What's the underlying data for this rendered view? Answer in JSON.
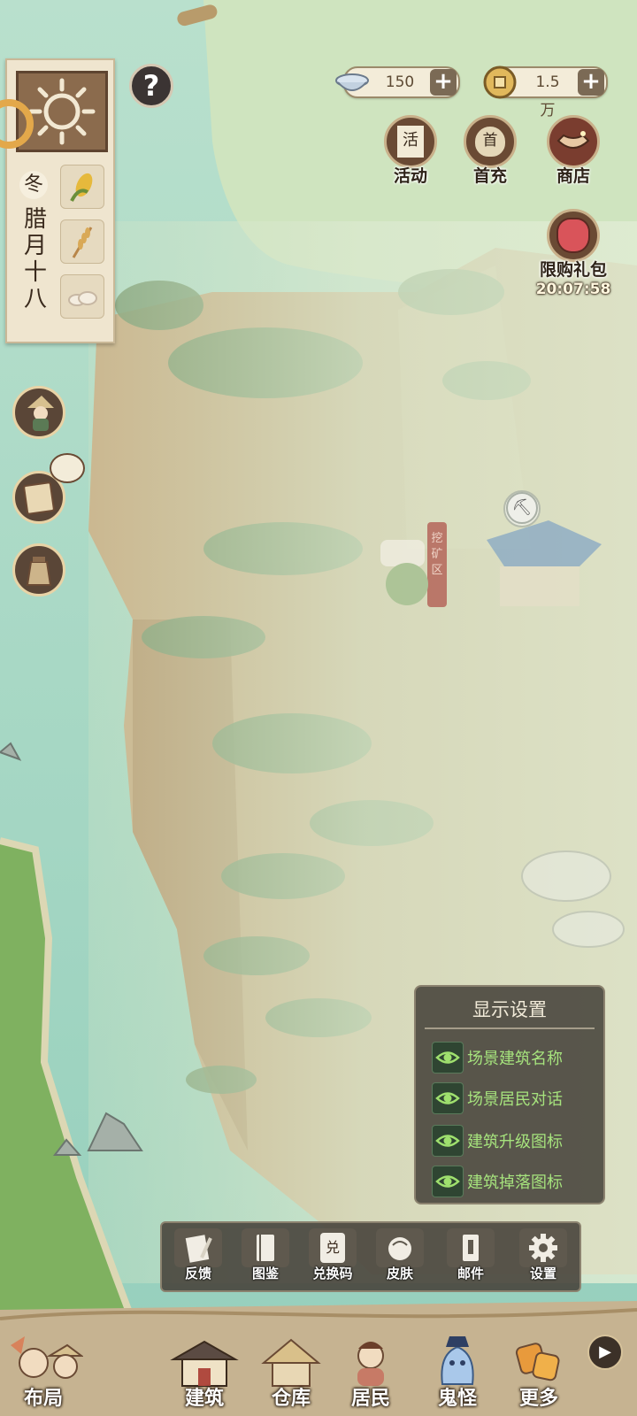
{
  "resources": {
    "bowl_amount": "150",
    "coin_amount": "1.5万"
  },
  "top_buttons": {
    "activity": "活动",
    "first_recharge": "首充",
    "shop": "商店",
    "limited_pack": "限购礼包",
    "limited_timer": "20:07:58",
    "activity_icon_char": "活",
    "first_recharge_icon_char": "首"
  },
  "calendar": {
    "season": "冬",
    "date": "腊月十八"
  },
  "help_label": "?",
  "map": {
    "area_sign": "挖矿区"
  },
  "display_settings": {
    "title": "显示设置",
    "options": [
      {
        "label": "场景建筑名称",
        "checked": true
      },
      {
        "label": "场景居民对话",
        "checked": true
      },
      {
        "label": "建筑升级图标",
        "checked": true
      },
      {
        "label": "建筑掉落图标",
        "checked": true
      }
    ]
  },
  "tools": {
    "feedback": "反馈",
    "catalog": "图鉴",
    "redeem_code": "兑换码",
    "skin": "皮肤",
    "mail": "邮件",
    "settings": "设置",
    "redeem_icon_char": "兑"
  },
  "nav": {
    "layout": "布局",
    "build": "建筑",
    "warehouse": "仓库",
    "residents": "居民",
    "ghosts": "鬼怪",
    "more": "更多",
    "arrow": "▶"
  },
  "colors": {
    "river": "#9fd2be",
    "fog": "#d6e6cc",
    "cliff": "#c9a57a",
    "panel": "#46423a",
    "option_text": "#a6e37d"
  }
}
